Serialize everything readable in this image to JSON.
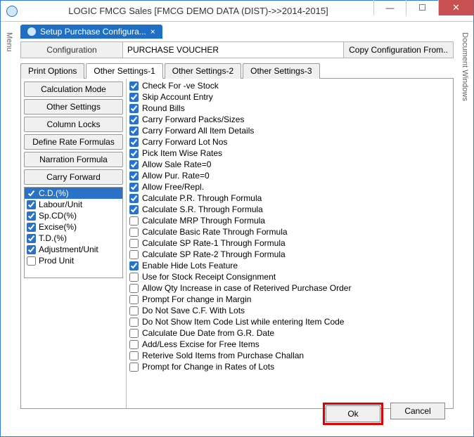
{
  "window": {
    "title": "LOGIC FMCG Sales  [FMCG DEMO DATA (DIST)->>2014-2015]"
  },
  "sidebars": {
    "left": "Menu",
    "right": "Document Windows"
  },
  "doc_tab": {
    "label": "Setup Purchase Configura...",
    "close_glyph": "×"
  },
  "config_row": {
    "label": "Configuration",
    "value": "PURCHASE VOUCHER",
    "copy_btn": "Copy Configuration From.."
  },
  "tabs": {
    "items": [
      "Print Options",
      "Other Settings-1",
      "Other Settings-2",
      "Other Settings-3"
    ],
    "active_index": 1
  },
  "left_panel_buttons": [
    "Calculation Mode",
    "Other Settings",
    "Column Locks",
    "Define Rate Formulas",
    "Narration Formula",
    "Carry Forward"
  ],
  "carry_forward": [
    {
      "label": "C.D.(%)",
      "checked": true,
      "selected": true
    },
    {
      "label": "Labour/Unit",
      "checked": true,
      "selected": false
    },
    {
      "label": "Sp.CD(%)",
      "checked": true,
      "selected": false
    },
    {
      "label": "Excise(%)",
      "checked": true,
      "selected": false
    },
    {
      "label": "T.D.(%)",
      "checked": true,
      "selected": false
    },
    {
      "label": "Adjustment/Unit",
      "checked": true,
      "selected": false
    },
    {
      "label": "Prod Unit",
      "checked": false,
      "selected": false
    }
  ],
  "settings_checks": [
    {
      "label": "Check For -ve Stock",
      "checked": true
    },
    {
      "label": "Skip Account Entry",
      "checked": true
    },
    {
      "label": "Round Bills",
      "checked": true
    },
    {
      "label": "Carry Forward Packs/Sizes",
      "checked": true
    },
    {
      "label": "Carry Forward All Item Details",
      "checked": true
    },
    {
      "label": "Carry Forward Lot Nos",
      "checked": true
    },
    {
      "label": "Pick Item Wise Rates",
      "checked": true
    },
    {
      "label": "Allow Sale Rate=0",
      "checked": true
    },
    {
      "label": "Allow Pur. Rate=0",
      "checked": true
    },
    {
      "label": "Allow Free/Repl.",
      "checked": true
    },
    {
      "label": "Calculate P.R. Through Formula",
      "checked": true
    },
    {
      "label": "Calculate S.R. Through Formula",
      "checked": true
    },
    {
      "label": "Calculate MRP Through Formula",
      "checked": false
    },
    {
      "label": "Calculate Basic Rate Through Formula",
      "checked": false
    },
    {
      "label": "Calculate SP Rate-1 Through Formula",
      "checked": false
    },
    {
      "label": "Calculate SP Rate-2 Through Formula",
      "checked": false
    },
    {
      "label": "Enable Hide Lots Feature",
      "checked": true
    },
    {
      "label": "Use for Stock Receipt Consignment",
      "checked": false
    },
    {
      "label": "Allow Qty Increase in case of Reterived Purchase Order",
      "checked": false
    },
    {
      "label": "Prompt For change in Margin",
      "checked": false
    },
    {
      "label": "Do Not Save C.F. With Lots",
      "checked": false
    },
    {
      "label": "Do Not Show Item Code List while entering Item Code",
      "checked": false
    },
    {
      "label": "Calculate Due Date from G.R. Date",
      "checked": false
    },
    {
      "label": "Add/Less Excise for Free Items",
      "checked": false
    },
    {
      "label": "Reterive Sold Items from Purchase Challan",
      "checked": false
    },
    {
      "label": "Prompt for Change in Rates of Lots",
      "checked": false
    }
  ],
  "footer": {
    "ok": "Ok",
    "cancel": "Cancel"
  }
}
